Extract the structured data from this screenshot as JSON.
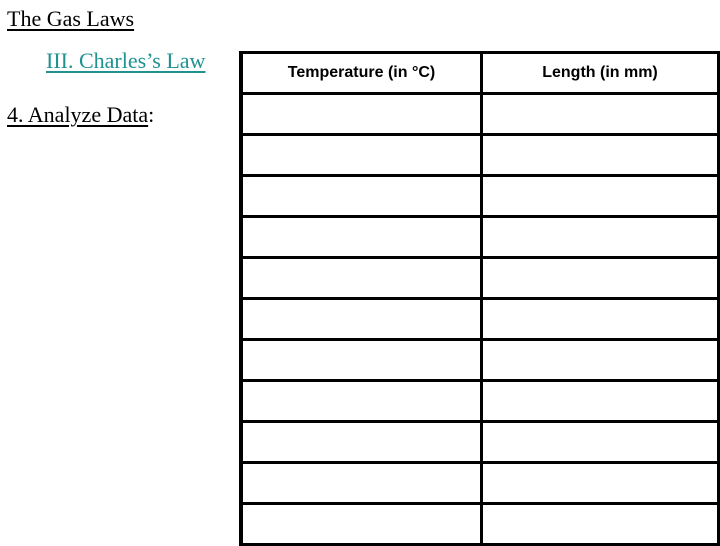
{
  "header": {
    "title": "The Gas Laws",
    "subtitle": "III.  Charles’s Law",
    "subtitle_color": "#1f9191",
    "step_label": "4.  Analyze Data",
    "step_suffix": ":"
  },
  "data_table": {
    "columns": [
      "Temperature (in °C)",
      "Length (in mm)"
    ],
    "rows": [
      [
        "",
        ""
      ],
      [
        "",
        ""
      ],
      [
        "",
        ""
      ],
      [
        "",
        ""
      ],
      [
        "",
        ""
      ],
      [
        "",
        ""
      ],
      [
        "",
        ""
      ],
      [
        "",
        ""
      ],
      [
        "",
        ""
      ],
      [
        "",
        ""
      ],
      [
        "",
        ""
      ]
    ]
  }
}
